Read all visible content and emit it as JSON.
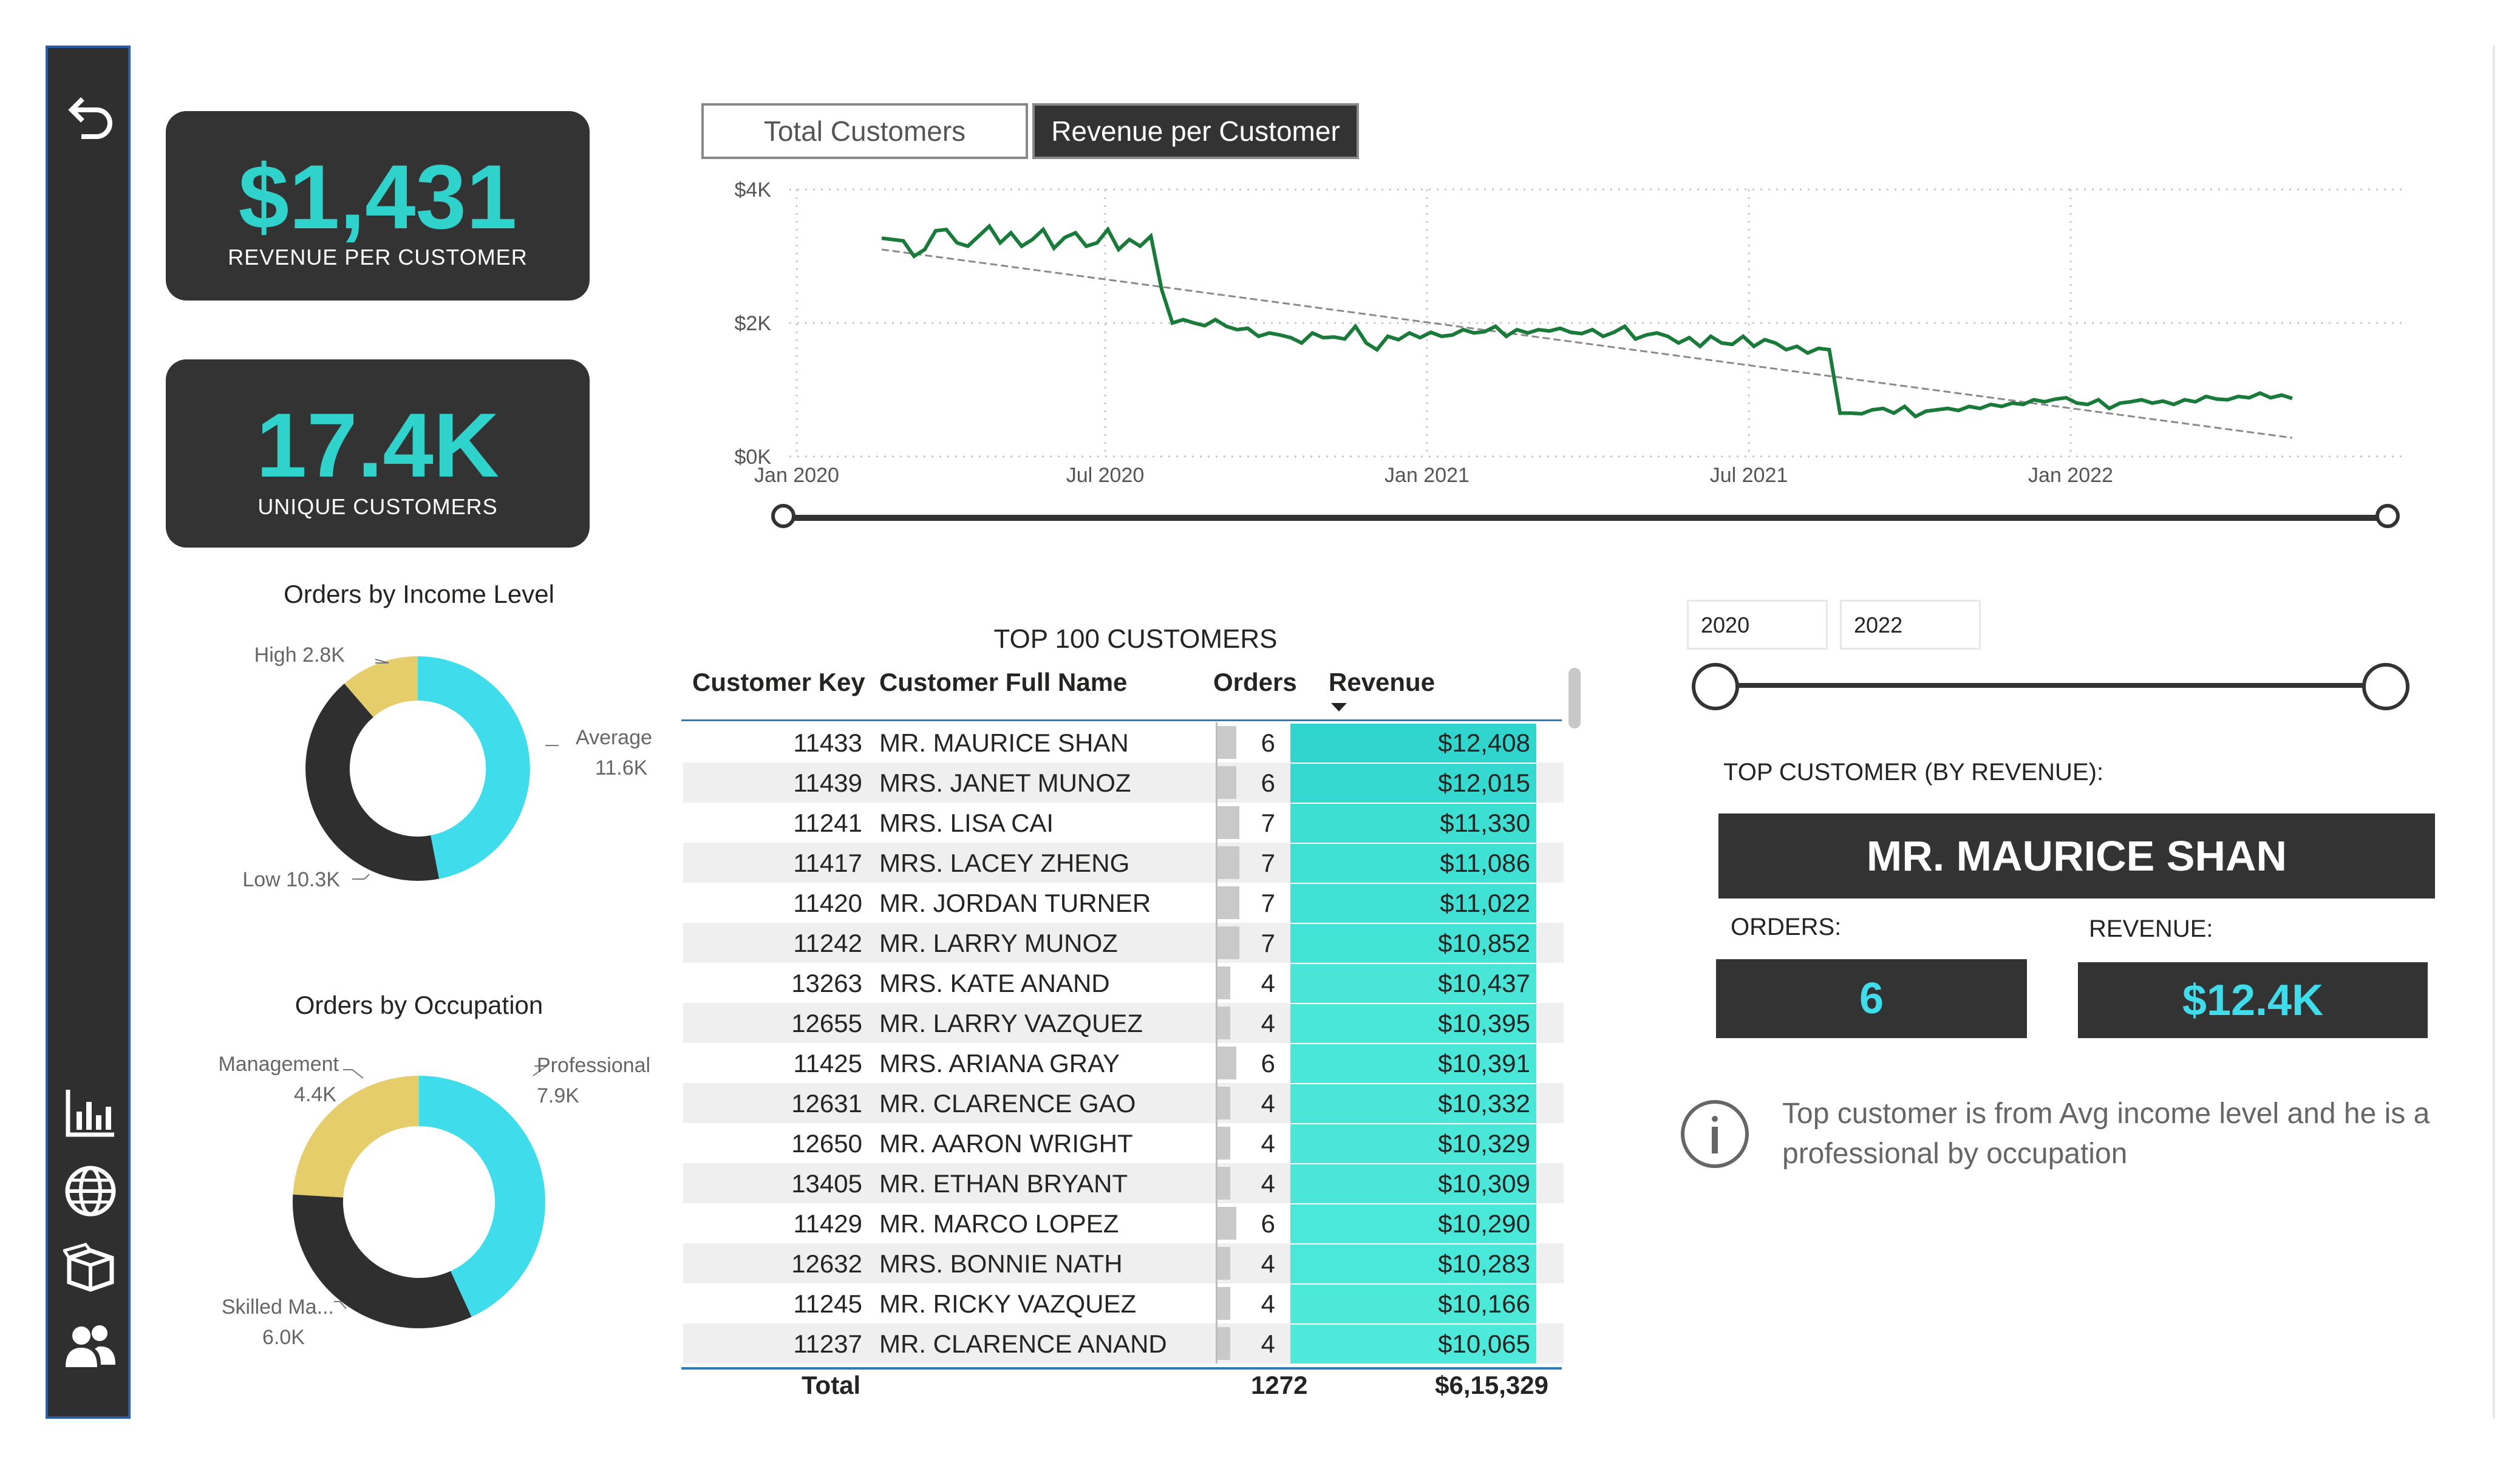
{
  "kpis": {
    "revenue_per_customer_value": "$1,431",
    "revenue_per_customer_label": "REVENUE PER CUSTOMER",
    "unique_customers_value": "17.4K",
    "unique_customers_label": "UNIQUE CUSTOMERS"
  },
  "toggle": {
    "option1": "Total Customers",
    "option2": "Revenue per Customer",
    "selected": "Revenue per Customer"
  },
  "sidebar": {
    "icons": [
      "back-arrow-icon",
      "bar-chart-icon",
      "globe-icon",
      "box-icon",
      "users-icon"
    ]
  },
  "colors": {
    "accent": "#2fd3cc",
    "dark": "#333333",
    "line": "#1a7a3a",
    "donut_cyan": "#3fdcec",
    "donut_dark": "#2f2f2f",
    "donut_yellow": "#e4cd6a"
  },
  "chart_data": [
    {
      "type": "line",
      "title": "",
      "x_ticks": [
        "Jan 2020",
        "Jul 2020",
        "Jan 2021",
        "Jul 2021",
        "Jan 2022"
      ],
      "y_ticks": [
        "$4K",
        "$2K",
        "$0K"
      ],
      "ylim": [
        0,
        4000
      ],
      "series": [
        {
          "values": [
            3270,
            3250,
            3230,
            3000,
            3100,
            3380,
            3400,
            3200,
            3150,
            3300,
            3450,
            3200,
            3350,
            3150,
            3250,
            3400,
            3120,
            3280,
            3350,
            3150,
            3200,
            3400,
            3100,
            3250,
            3150,
            3300,
            2500,
            2000,
            2050,
            2000,
            1960,
            2050,
            1950,
            1900,
            1920,
            1800,
            1850,
            1820,
            1780,
            1700,
            1850,
            1780,
            1790,
            1760,
            1950,
            1700,
            1600,
            1800,
            1750,
            1850,
            1780,
            1860,
            1800,
            1820,
            1900,
            1850,
            1870,
            1950,
            1800,
            1900,
            1850,
            1900,
            1880,
            1920,
            1860,
            1840,
            1900,
            1800,
            1860,
            1950,
            1760,
            1820,
            1850,
            1800,
            1700,
            1780,
            1650,
            1800,
            1700,
            1680,
            1800,
            1650,
            1750,
            1700,
            1600,
            1650,
            1550,
            1620,
            1600,
            650,
            650,
            640,
            700,
            720,
            650,
            750,
            600,
            680,
            700,
            720,
            690,
            750,
            720,
            780,
            750,
            800,
            780,
            850,
            820,
            860,
            880,
            800,
            780,
            850,
            720,
            800,
            820,
            850,
            800,
            830,
            780,
            850,
            820,
            900,
            860,
            850,
            900,
            880,
            950,
            880,
            920,
            870
          ],
          "x_range": [
            "Jan 2020",
            "Jun 2022"
          ]
        }
      ],
      "trend_line": {
        "start": 3100,
        "end": 280
      }
    },
    {
      "type": "pie",
      "title": "Orders by Income Level",
      "slices": [
        {
          "label": "Average",
          "value": 11.6,
          "display": "11.6K"
        },
        {
          "label": "Low",
          "value": 10.3,
          "display": "10.3K"
        },
        {
          "label": "High",
          "value": 2.8,
          "display": "2.8K"
        }
      ]
    },
    {
      "type": "pie",
      "title": "Orders by Occupation",
      "slices": [
        {
          "label": "Professional",
          "value": 7.9,
          "display": "7.9K"
        },
        {
          "label": "Skilled Ma...",
          "value": 6.0,
          "display": "6.0K"
        },
        {
          "label": "Management",
          "value": 4.4,
          "display": "4.4K"
        }
      ]
    }
  ],
  "table": {
    "title": "TOP 100 CUSTOMERS",
    "headers": [
      "Customer Key",
      "Customer Full Name",
      "Orders",
      "Revenue"
    ],
    "rows": [
      [
        "11433",
        "MR. MAURICE SHAN",
        "6",
        "$12,408"
      ],
      [
        "11439",
        "MRS. JANET MUNOZ",
        "6",
        "$12,015"
      ],
      [
        "11241",
        "MRS. LISA CAI",
        "7",
        "$11,330"
      ],
      [
        "11417",
        "MRS. LACEY ZHENG",
        "7",
        "$11,086"
      ],
      [
        "11420",
        "MR. JORDAN TURNER",
        "7",
        "$11,022"
      ],
      [
        "11242",
        "MR. LARRY MUNOZ",
        "7",
        "$10,852"
      ],
      [
        "13263",
        "MRS. KATE ANAND",
        "4",
        "$10,437"
      ],
      [
        "12655",
        "MR. LARRY VAZQUEZ",
        "4",
        "$10,395"
      ],
      [
        "11425",
        "MRS. ARIANA GRAY",
        "6",
        "$10,391"
      ],
      [
        "12631",
        "MR. CLARENCE GAO",
        "4",
        "$10,332"
      ],
      [
        "12650",
        "MR. AARON WRIGHT",
        "4",
        "$10,329"
      ],
      [
        "13405",
        "MR. ETHAN BRYANT",
        "4",
        "$10,309"
      ],
      [
        "11429",
        "MR. MARCO LOPEZ",
        "6",
        "$10,290"
      ],
      [
        "12632",
        "MRS. BONNIE NATH",
        "4",
        "$10,283"
      ],
      [
        "11245",
        "MR. RICKY VAZQUEZ",
        "4",
        "$10,166"
      ],
      [
        "11237",
        "MR. CLARENCE ANAND",
        "4",
        "$10,065"
      ]
    ],
    "total_label": "Total",
    "total_orders": "1272",
    "total_revenue": "$6,15,329"
  },
  "year_filter": {
    "start": "2020",
    "end": "2022"
  },
  "top_customer": {
    "heading": "TOP CUSTOMER (BY REVENUE):",
    "name": "MR. MAURICE SHAN",
    "orders_label": "ORDERS:",
    "orders_value": "6",
    "revenue_label": "REVENUE:",
    "revenue_value": "$12.4K",
    "note": "Top customer is from Avg income level and he is a professional by occupation"
  }
}
